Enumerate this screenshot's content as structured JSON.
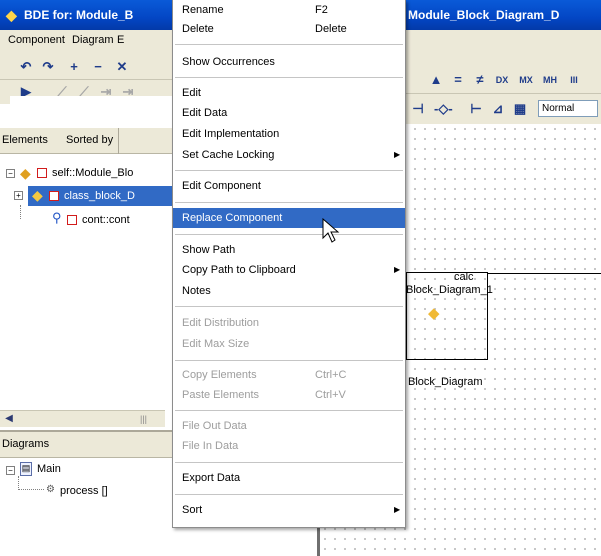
{
  "title_left": "BDE for: Module_B",
  "title_right": "Module_Block_Diagram_D",
  "menubar": [
    "Component",
    "Diagram",
    "E"
  ],
  "elements_panel": {
    "tab_elements": "Elements",
    "tab_sorted": "Sorted by",
    "items": [
      {
        "label": "self::Module_Blo",
        "expander": "−"
      },
      {
        "label": "class_block_D",
        "expander": "+"
      },
      {
        "label": "cont::cont",
        "expander": ""
      }
    ]
  },
  "diagrams_panel": {
    "title": "Diagrams",
    "items": [
      {
        "label": "Main",
        "expander": "−"
      },
      {
        "label": "process []",
        "expander": ""
      }
    ]
  },
  "toolbar": {
    "normal_select": "Normal"
  },
  "canvas": {
    "block_label_1": "calc",
    "block_label_2": "Block_Diagram_1",
    "block_caption": "Block_Diagram"
  },
  "context_menu": {
    "items": [
      {
        "label": "Rename",
        "shortcut": "F2",
        "disabled": false,
        "submenu": false,
        "highlighted": false
      },
      {
        "label": "Delete",
        "shortcut": "Delete",
        "disabled": false,
        "submenu": false,
        "highlighted": false
      },
      {
        "label": "Show Occurrences",
        "shortcut": "",
        "disabled": false,
        "submenu": false,
        "highlighted": false
      },
      {
        "label": "Edit",
        "shortcut": "",
        "disabled": false,
        "submenu": false,
        "highlighted": false
      },
      {
        "label": "Edit Data",
        "shortcut": "",
        "disabled": false,
        "submenu": false,
        "highlighted": false
      },
      {
        "label": "Edit Implementation",
        "shortcut": "",
        "disabled": false,
        "submenu": false,
        "highlighted": false
      },
      {
        "label": "Set Cache Locking",
        "shortcut": "",
        "disabled": false,
        "submenu": true,
        "highlighted": false
      },
      {
        "label": "Edit Component",
        "shortcut": "",
        "disabled": false,
        "submenu": false,
        "highlighted": false
      },
      {
        "label": "Replace Component",
        "shortcut": "",
        "disabled": false,
        "submenu": false,
        "highlighted": true
      },
      {
        "label": "Show Path",
        "shortcut": "",
        "disabled": false,
        "submenu": false,
        "highlighted": false
      },
      {
        "label": "Copy Path to Clipboard",
        "shortcut": "",
        "disabled": false,
        "submenu": true,
        "highlighted": false
      },
      {
        "label": "Notes",
        "shortcut": "",
        "disabled": false,
        "submenu": false,
        "highlighted": false
      },
      {
        "label": "Edit Distribution",
        "shortcut": "",
        "disabled": true,
        "submenu": false,
        "highlighted": false
      },
      {
        "label": "Edit Max Size",
        "shortcut": "",
        "disabled": true,
        "submenu": false,
        "highlighted": false
      },
      {
        "label": "Copy Elements",
        "shortcut": "Ctrl+C",
        "disabled": true,
        "submenu": false,
        "highlighted": false
      },
      {
        "label": "Paste Elements",
        "shortcut": "Ctrl+V",
        "disabled": true,
        "submenu": false,
        "highlighted": false
      },
      {
        "label": "File Out Data",
        "shortcut": "",
        "disabled": true,
        "submenu": false,
        "highlighted": false
      },
      {
        "label": "File In Data",
        "shortcut": "",
        "disabled": true,
        "submenu": false,
        "highlighted": false
      },
      {
        "label": "Export Data",
        "shortcut": "",
        "disabled": false,
        "submenu": false,
        "highlighted": false
      },
      {
        "label": "Sort",
        "shortcut": "",
        "disabled": false,
        "submenu": true,
        "highlighted": false
      }
    ]
  },
  "colors": {
    "title_bar": "#0346c4",
    "menu_highlight": "#316ac5",
    "chrome": "#ece9d8",
    "tree_selection": "#316ac5"
  }
}
